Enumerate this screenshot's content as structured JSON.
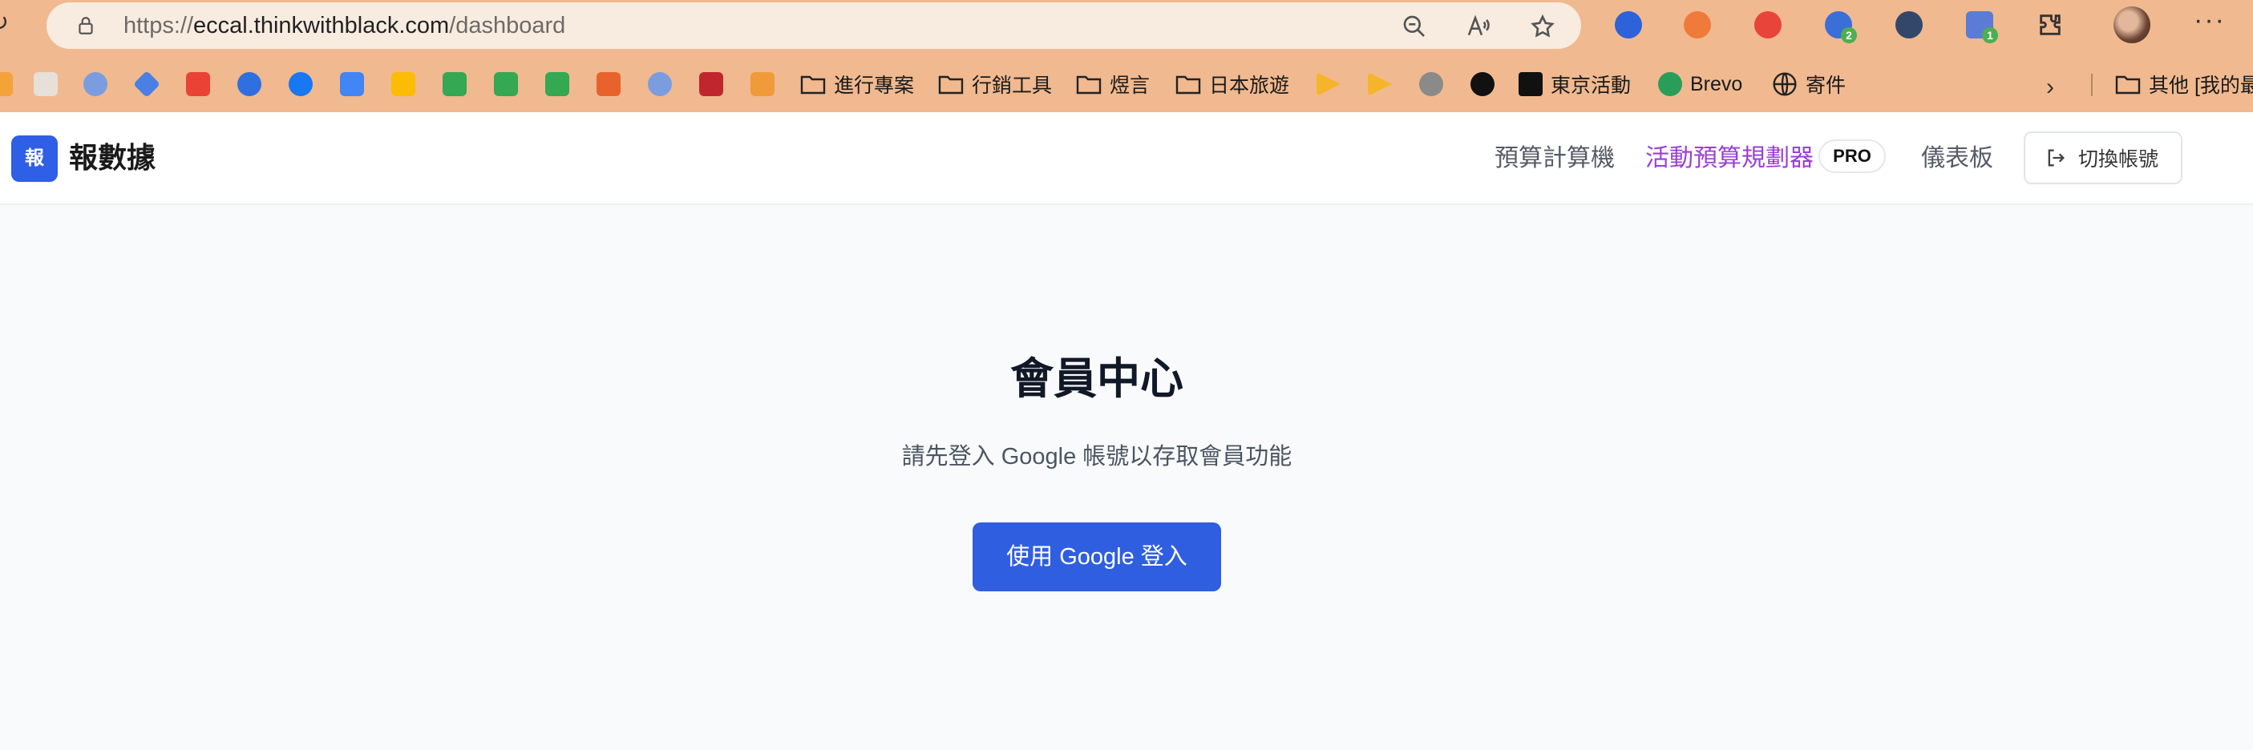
{
  "browser": {
    "url_scheme": "https://",
    "url_host": "eccal.thinkwithblack.com",
    "url_path": "/dashboard",
    "extension_badges": [
      "2",
      "1"
    ],
    "bookmark_folders": [
      "進行專案",
      "行銷工具",
      "煜言",
      "日本旅遊",
      "東京活動",
      "Brevo",
      "寄件",
      "其他 [我的最"
    ]
  },
  "app": {
    "logo_text": "報",
    "brand_name": "報數據",
    "nav": {
      "budget_calculator": "預算計算機",
      "campaign_planner": "活動預算規劃器",
      "pro_badge": "PRO",
      "dashboard": "儀表板",
      "switch_account": "切換帳號"
    }
  },
  "main": {
    "title": "會員中心",
    "subtitle": "請先登入 Google 帳號以存取會員功能",
    "login_button": "使用 Google 登入"
  },
  "colors": {
    "chrome_bg": "#f0b98f",
    "primary": "#2f5fe0",
    "active_nav": "#9b3fd6"
  }
}
